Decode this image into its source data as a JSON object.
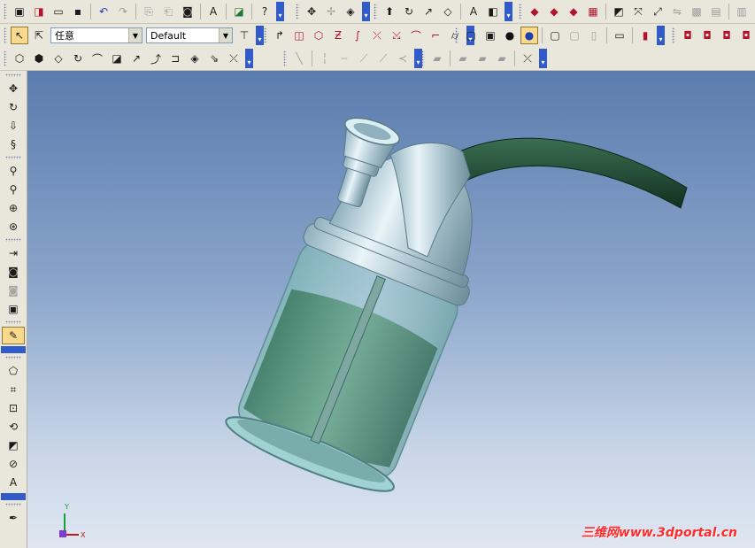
{
  "toolbar_row1": {
    "groups": [
      [
        "new-doc-icon",
        "new-part-icon",
        "open-folder-icon",
        "save-icon"
      ],
      [
        "undo-icon",
        "redo-icon"
      ],
      [
        "copy-props-icon",
        "paste-props-icon",
        "camera-icon"
      ],
      [
        "find-text-icon"
      ],
      [
        "measure-icon"
      ],
      [
        "help-cursor-icon"
      ],
      [
        "rotate-3d-icon",
        "move-tool-icon",
        "render-icon"
      ],
      [
        "extrude-icon",
        "revolve-icon",
        "sweep-icon",
        "loft-icon"
      ],
      [
        "text-icon",
        "section-icon"
      ],
      [
        "shaded-red-icon",
        "shaded-dark-icon",
        "shaded-solid-icon",
        "hatch-icon"
      ],
      [
        "edit-face-icon",
        "transform-icon",
        "scale-icon",
        "mirror-icon",
        "pattern-icon",
        "array-icon"
      ],
      [
        "settings-icon"
      ]
    ]
  },
  "toolbar_row2": {
    "select_label": "任意",
    "filter_value": "Default",
    "groups": [
      [
        "pointer-icon",
        "select-filter-icon"
      ],
      [
        "tree-icon"
      ],
      [
        "sketch-icon",
        "sketch-rect-icon",
        "sketch-polygon-icon",
        "sketch-curve-icon",
        "sketch-spline-icon",
        "trim-icon",
        "extend-icon",
        "fillet-icon",
        "chamfer-icon",
        "cylinder-icon"
      ],
      [
        "box-view-icon",
        "box-wire-icon",
        "sphere-black-icon",
        "sphere-blue-icon"
      ],
      [
        "iso-view-icon",
        "front-view-icon",
        "side-view-icon"
      ],
      [
        "display-icon"
      ],
      [
        "red-box-icon"
      ],
      [
        "shade-1-icon",
        "shade-2-icon",
        "shade-3-icon",
        "shade-4-icon"
      ]
    ]
  },
  "toolbar_row3": {
    "groups": [
      [
        "curve-1-icon",
        "curve-2-icon",
        "curve-3-icon",
        "curve-4-icon",
        "curve-5-icon",
        "curve-6-icon",
        "curve-7-icon",
        "curve-8-icon",
        "curve-9-icon",
        "curve-10-icon",
        "curve-11-icon",
        "curve-12-icon"
      ],
      [
        "line-tool-icon",
        "polyline-icon",
        "dash-line-icon",
        "angle-line-icon",
        "tangent-icon",
        "bisector-icon"
      ],
      [
        "part-icon-1",
        "part-icon-2",
        "part-icon-3",
        "part-icon-4"
      ],
      [
        "assembly-icon"
      ]
    ]
  },
  "sidebar": {
    "items": [
      "pan-icon",
      "rotate-view-icon",
      "walk-icon",
      "spin-icon",
      "zoom-icon",
      "zoom-window-icon",
      "zoom-fit-icon",
      "orbit-icon",
      "look-at-icon",
      "camera-view-icon",
      "light-icon",
      "scene-icon",
      "texture-paint-icon",
      "smart-select-icon",
      "crop-icon",
      "frame-icon",
      "rotate-face-icon",
      "edge-icon",
      "circle-icon",
      "text-tool-icon",
      "eyedropper-icon"
    ]
  },
  "viewport": {
    "axis_x": "X",
    "axis_y": "Y",
    "watermark": "三维网www.3dportal.cn",
    "colors": {
      "hose": "#1f4d36",
      "glass": "#9fd3d0",
      "water": "#4f8a70",
      "metal": "#c8dde5"
    }
  }
}
